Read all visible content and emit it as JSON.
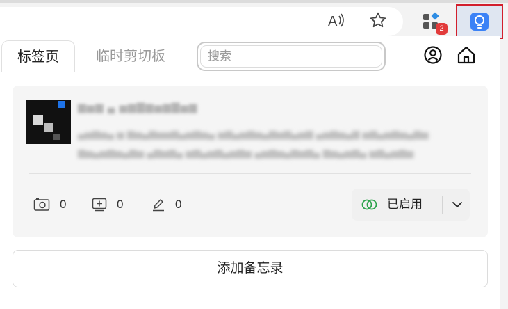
{
  "browser": {
    "extensions_badge": "2",
    "icons": {
      "read_aloud": "read-aloud-icon",
      "favorite": "star-icon",
      "extensions": "extensions-icon",
      "memo_extension": "lightbulb-icon"
    }
  },
  "popup": {
    "tabs": [
      {
        "label": "标签页",
        "active": true
      },
      {
        "label": "临时剪切板",
        "active": false
      }
    ],
    "search": {
      "placeholder": "搜索",
      "value": ""
    },
    "icons": {
      "account": "account-icon",
      "home": "home-icon"
    }
  },
  "card": {
    "stats": {
      "images": "0",
      "additions": "0",
      "edits": "0"
    },
    "status": {
      "label": "已启用",
      "color": "#2aa34a"
    }
  },
  "add_button": {
    "label": "添加备忘录"
  },
  "colors": {
    "accent": "#3b82f6",
    "highlight_border": "#d21f2c",
    "badge": "#e23b3b",
    "enabled": "#2aa34a"
  }
}
